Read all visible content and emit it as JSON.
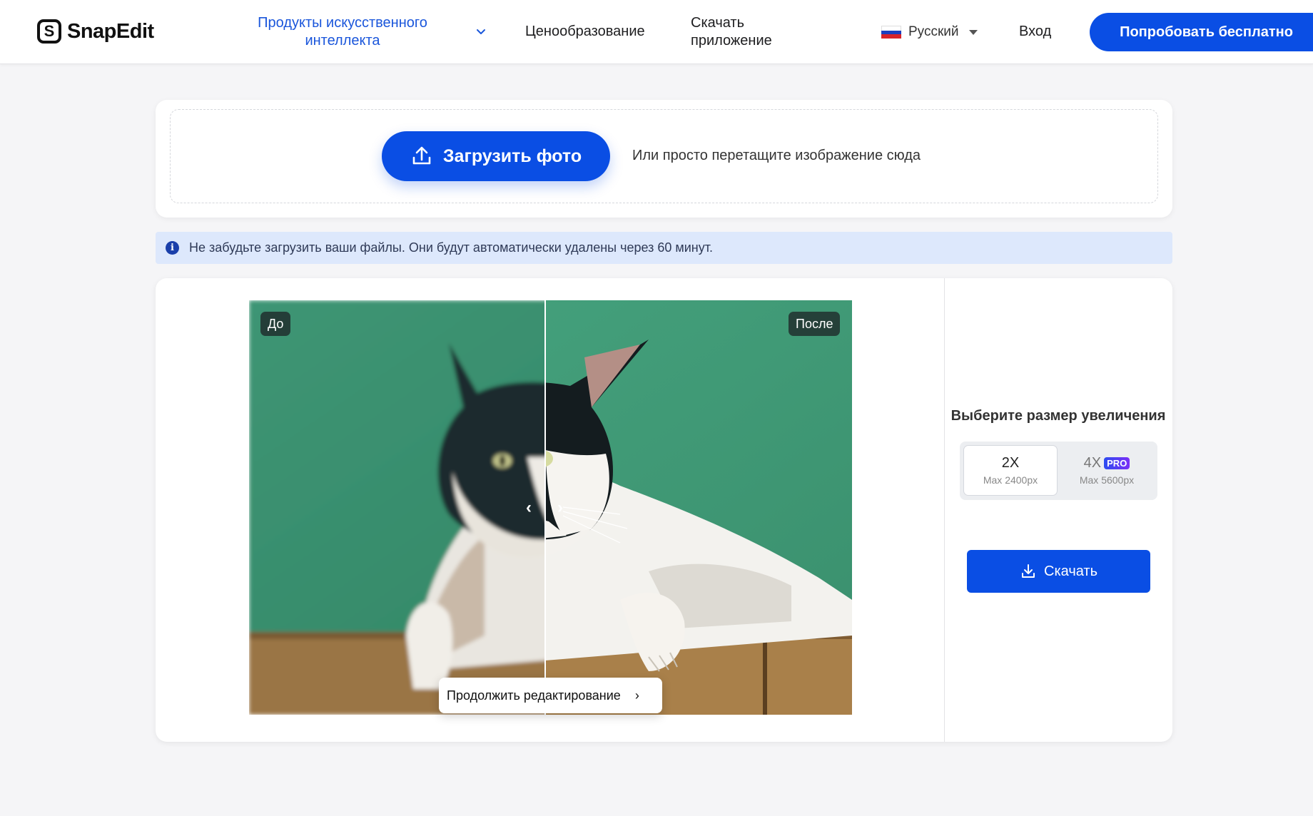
{
  "header": {
    "logo_text": "SnapEdit",
    "logo_mark": "S",
    "nav_ai_products": "Продукты искусственного интеллекта",
    "nav_pricing": "Ценообразование",
    "nav_download_app": "Скачать приложение",
    "language": "Русский",
    "login": "Вход",
    "try_free": "Попробовать бесплатно"
  },
  "upload": {
    "button_label": "Загрузить фото",
    "drop_hint": "Или просто перетащите изображение сюда",
    "icon": "upload-icon"
  },
  "info_banner": {
    "icon": "info-icon",
    "icon_glyph": "i",
    "text": "Не забудьте загрузить ваши файлы. Они будут автоматически удалены через 60 минут."
  },
  "compare": {
    "before_label": "До",
    "after_label": "После",
    "left_arrow": "‹",
    "right_arrow": "›",
    "continue_label": "Продолжить редактирование",
    "continue_chevron": "›"
  },
  "upscale": {
    "title": "Выберите размер увеличения",
    "options": [
      {
        "label": "2X",
        "sub": "Max 2400px",
        "selected": true
      },
      {
        "label": "4X",
        "sub": "Max 5600px",
        "badge": "PRO",
        "selected": false
      }
    ],
    "download_label": "Скачать"
  },
  "colors": {
    "accent": "#0a4ee4",
    "nav_active": "#1a56db",
    "info_bg": "#dde8fc",
    "pro_gradient_start": "#2d4cf0",
    "pro_gradient_end": "#7b2ff7"
  }
}
